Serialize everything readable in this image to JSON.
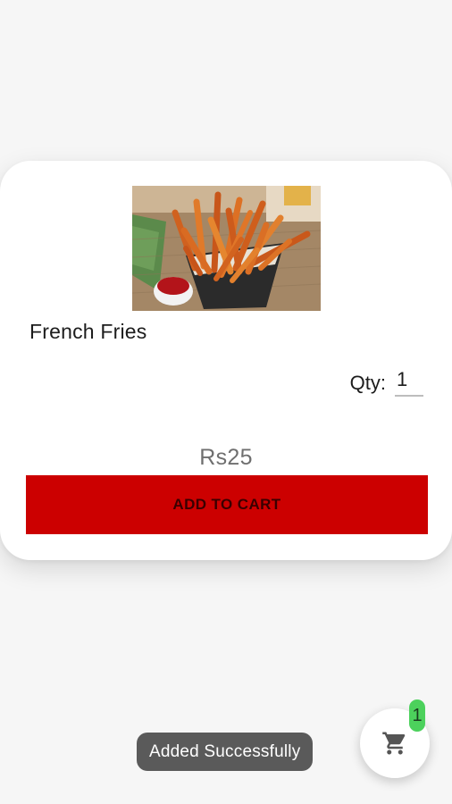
{
  "product": {
    "name": "French Fries",
    "image_subject": "french-fries-cone-with-ketchup",
    "quantity_label": "Qty:",
    "quantity_value": "1",
    "price": "Rs25",
    "add_to_cart_label": "ADD TO CART"
  },
  "toast": {
    "message": "Added Successfully"
  },
  "cart": {
    "icon": "shopping-cart-icon",
    "count": "1"
  },
  "colors": {
    "accent_red": "#cc0000",
    "badge_green": "#4cd15c",
    "toast_bg": "#5a5a5a"
  }
}
